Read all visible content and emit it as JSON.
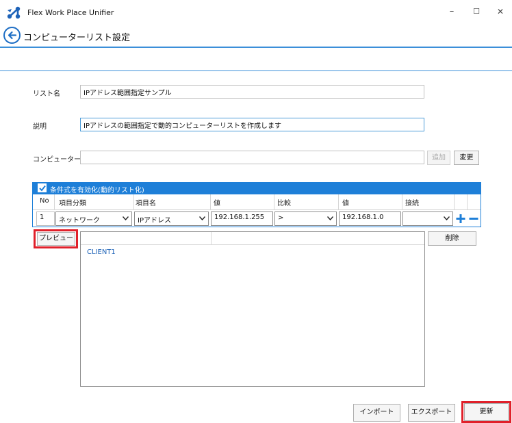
{
  "window": {
    "title": "Flex Work Place Unifier",
    "minimize": "–",
    "maximize": "☐",
    "close": "✕"
  },
  "header": {
    "title": "コンピューターリスト設定"
  },
  "form": {
    "list_name_label": "リスト名",
    "list_name_value": "IPアドレス範囲指定サンプル",
    "description_label": "説明",
    "description_value": "IPアドレスの範囲指定で動的コンピューターリストを作成します",
    "computer_name_label": "コンピューター名",
    "computer_name_value": "",
    "add_button": "追加",
    "change_button": "変更"
  },
  "conditions": {
    "enable_label": "条件式を有効化(動的リスト化)",
    "enabled": true,
    "columns": [
      "No",
      "項目分類",
      "項目名",
      "値",
      "比較",
      "値",
      "接続"
    ],
    "rows": [
      {
        "no": "1",
        "category": "ネットワーク",
        "item": "IPアドレス",
        "value1": "192.168.1.255",
        "compare": ">",
        "value2": "192.168.1.0",
        "connect": ""
      }
    ],
    "add_icon": "plus-icon",
    "remove_icon": "minus-icon"
  },
  "preview": {
    "button": "プレビュー",
    "delete_button": "削除",
    "results": [
      "CLIENT1"
    ]
  },
  "footer": {
    "import_button": "インポート",
    "export_button": "エクスポート",
    "update_button": "更新"
  },
  "colors": {
    "accent": "#1e7fd8",
    "highlight": "#e0202a",
    "link_text": "#1e63b8"
  }
}
